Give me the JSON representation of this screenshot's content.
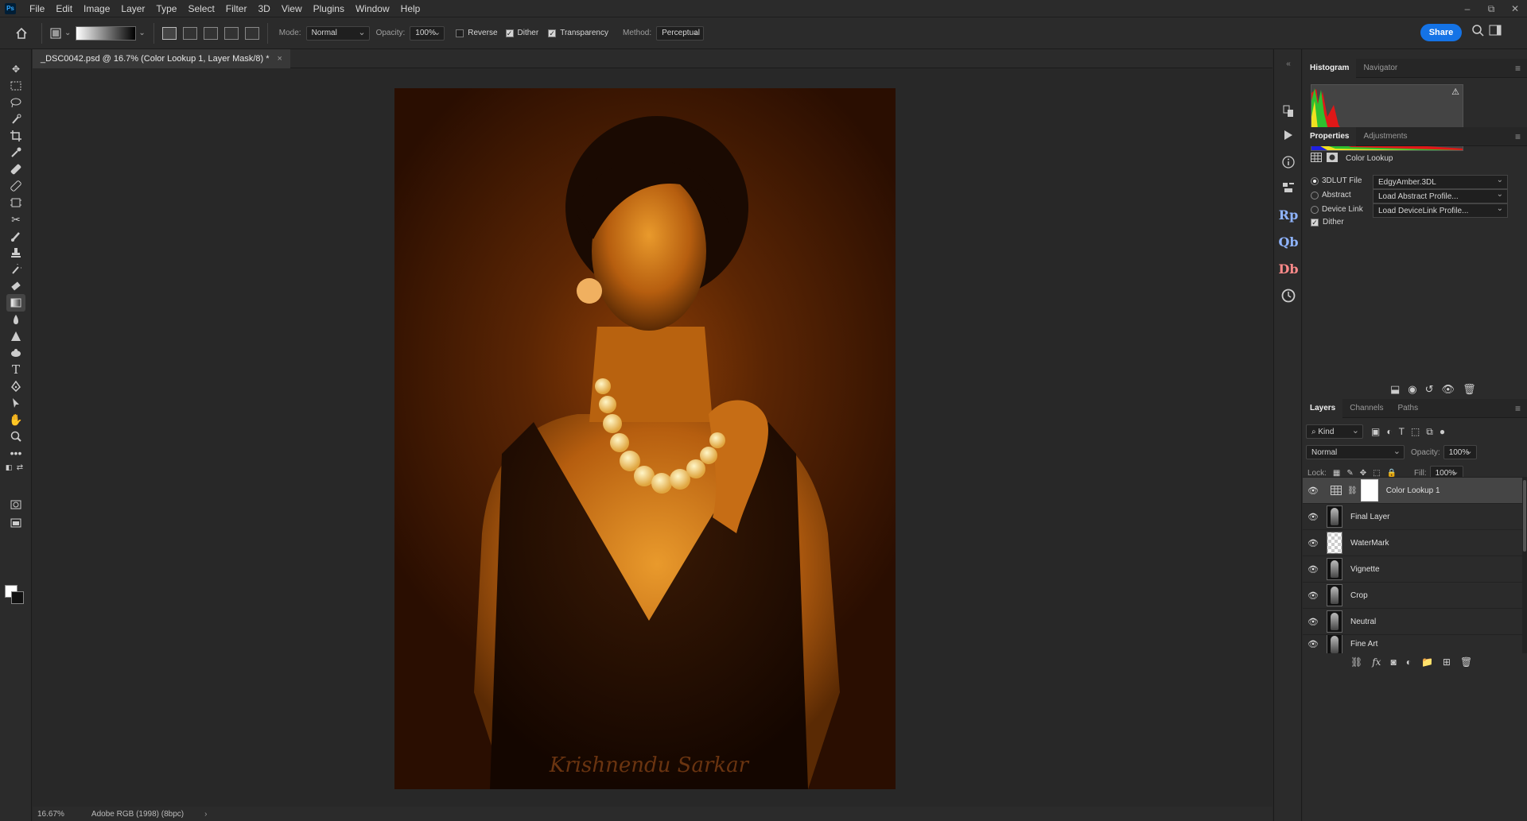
{
  "app": {
    "logo": "Ps"
  },
  "menu": [
    "File",
    "Edit",
    "Image",
    "Layer",
    "Type",
    "Select",
    "Filter",
    "3D",
    "View",
    "Plugins",
    "Window",
    "Help"
  ],
  "window_controls": {
    "minimize": "–",
    "restore": "⧉",
    "close": "✕"
  },
  "options": {
    "mode_label": "Mode:",
    "mode_value": "Normal",
    "opacity_label": "Opacity:",
    "opacity_value": "100%",
    "reverse_label": "Reverse",
    "reverse_checked": false,
    "dither_label": "Dither",
    "dither_checked": true,
    "transparency_label": "Transparency",
    "transparency_checked": true,
    "method_label": "Method:",
    "method_value": "Perceptual",
    "share_label": "Share"
  },
  "document": {
    "tab_title": "_DSC0042.psd @ 16.7% (Color Lookup 1, Layer Mask/8) *",
    "close_glyph": "×",
    "watermark_signature": "Krishnendu Sarkar"
  },
  "status": {
    "zoom": "16.67%",
    "profile": "Adobe RGB (1998) (8bpc)",
    "arrow": "›"
  },
  "tools": [
    "move-tool",
    "marquee-tool",
    "lasso-tool",
    "quick-select-tool",
    "crop-tool",
    "eyedropper-tool",
    "healing-tool",
    "brush-tool-alt",
    "frame-tool",
    "scissors-tool",
    "brush-tool",
    "stamp-tool",
    "history-brush-tool",
    "eraser-tool",
    "gradient-tool",
    "blur-tool",
    "dodge-tool",
    "sponge-tool",
    "type-tool",
    "pen-tool",
    "path-select-tool",
    "hand-tool",
    "zoom-tool",
    "more-tools"
  ],
  "strip": {
    "rp_label": "Rp",
    "qb_label": "Qb",
    "db_label": "Db"
  },
  "histogram_panel": {
    "tab_histogram": "Histogram",
    "tab_navigator": "Navigator"
  },
  "properties_panel": {
    "tab_properties": "Properties",
    "tab_adjustments": "Adjustments",
    "title": "Color Lookup",
    "lut_label": "3DLUT File",
    "lut_value": "EdgyAmber.3DL",
    "abstract_label": "Abstract",
    "abstract_value": "Load Abstract Profile...",
    "device_label": "Device Link",
    "device_value": "Load DeviceLink Profile...",
    "dither_label": "Dither",
    "selected_option": "3DLUT File",
    "dither_checked": true
  },
  "layers_panel": {
    "tab_layers": "Layers",
    "tab_channels": "Channels",
    "tab_paths": "Paths",
    "kind_label": "Kind",
    "blend_mode": "Normal",
    "opacity_label": "Opacity:",
    "opacity_value": "100%",
    "lock_label": "Lock:",
    "fill_label": "Fill:",
    "fill_value": "100%",
    "layers": [
      {
        "name": "Color Lookup 1",
        "type": "adjustment",
        "visible": true,
        "selected": true
      },
      {
        "name": "Final Layer",
        "type": "image",
        "visible": true,
        "selected": false
      },
      {
        "name": "WaterMark",
        "type": "transparent",
        "visible": true,
        "selected": false
      },
      {
        "name": "Vignette",
        "type": "image",
        "visible": true,
        "selected": false
      },
      {
        "name": "Crop",
        "type": "image",
        "visible": true,
        "selected": false
      },
      {
        "name": "Neutral",
        "type": "image",
        "visible": true,
        "selected": false
      },
      {
        "name": "Fine Art",
        "type": "image",
        "visible": true,
        "selected": false
      }
    ]
  },
  "colors": {
    "accent": "#1473e6",
    "artwork_tone": "#8a3d06",
    "panel_bg": "#2b2b2b",
    "canvas_bg": "#282828"
  }
}
